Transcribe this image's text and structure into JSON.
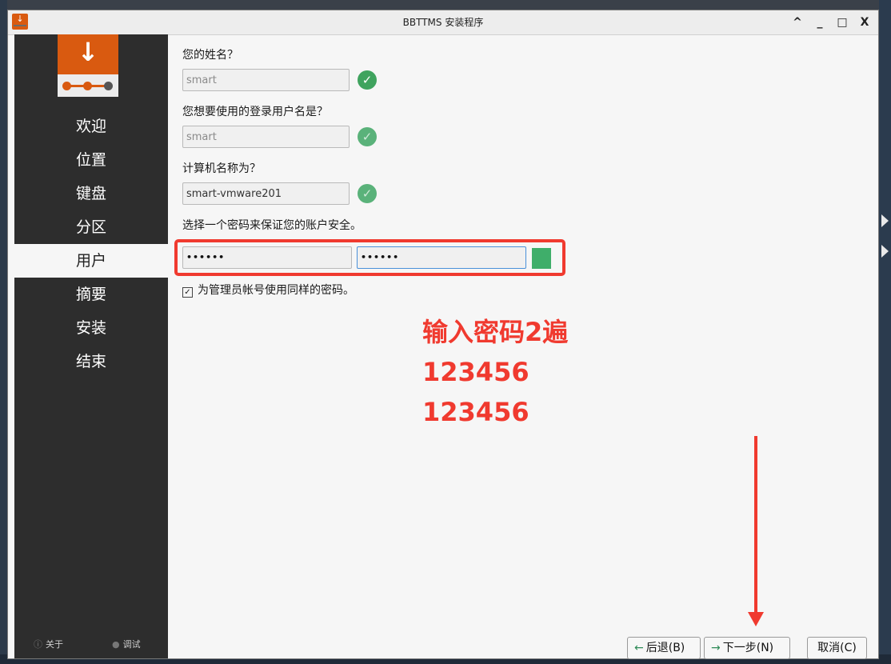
{
  "window": {
    "title": "BBTTMS 安装程序",
    "controls": [
      "^",
      "_",
      "□",
      "X"
    ]
  },
  "sidebar": {
    "items": [
      {
        "label": "欢迎"
      },
      {
        "label": "位置"
      },
      {
        "label": "键盘"
      },
      {
        "label": "分区"
      },
      {
        "label": "用户",
        "active": true
      },
      {
        "label": "摘要"
      },
      {
        "label": "安装"
      },
      {
        "label": "结束"
      }
    ],
    "footer": {
      "about": "关于",
      "debug": "调试"
    }
  },
  "form": {
    "name_question": "您的姓名？",
    "name_value": "smart",
    "login_question": "您想要使用的登录用户名是？",
    "login_value": "smart",
    "hostname_question": "计算机名称为？",
    "hostname_value": "smart-vmware201",
    "password_question": "选择一个密码来保证您的账户安全。",
    "password_value": "••••••",
    "password_confirm_value": "••••••",
    "admin_same_password_label": "为管理员帐号使用同样的密码。",
    "admin_same_password_checked": true
  },
  "annotation": {
    "line1": "输入密码2遍",
    "line2": "123456",
    "line3": "123456",
    "color": "#f03a2f"
  },
  "buttons": {
    "back": "后退(B)",
    "next": "下一步(N)",
    "cancel": "取消(C)"
  },
  "colors": {
    "accent": "#d95a10",
    "sidebar_bg": "#2d2d2d",
    "ok_green": "#3fa35e",
    "annotation_red": "#f03a2f"
  }
}
